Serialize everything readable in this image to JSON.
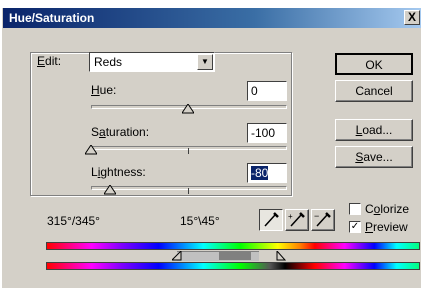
{
  "window": {
    "title": "Hue/Saturation",
    "close_glyph": "X"
  },
  "edit": {
    "label_prefix": "",
    "label_hotkey": "E",
    "label_rest": "dit:",
    "selected": "Reds"
  },
  "hue": {
    "hotkey": "H",
    "rest": "ue:",
    "value": "0",
    "level": 0
  },
  "saturation": {
    "pre": "S",
    "hotkey": "a",
    "rest": "turation:",
    "value": "-100",
    "level": -100
  },
  "lightness": {
    "pre": "L",
    "hotkey": "i",
    "rest": "ghtness:",
    "value": "-80",
    "level": -80
  },
  "range": {
    "left": "315°/345°",
    "right": "15°\\45°"
  },
  "buttons": {
    "ok": "OK",
    "cancel": "Cancel",
    "load_hotkey": "L",
    "load_rest": "oad...",
    "save_hotkey": "S",
    "save_rest": "ave..."
  },
  "colorize": {
    "pre": "C",
    "hotkey": "o",
    "rest": "lorize",
    "checked": false
  },
  "preview": {
    "hotkey": "P",
    "rest": "review",
    "checked": true,
    "check_glyph": "✓"
  },
  "colors": {
    "titlebar_start": "#0a246a",
    "dialog_bg": "#d4d0c8",
    "selection": "#0a246a"
  }
}
